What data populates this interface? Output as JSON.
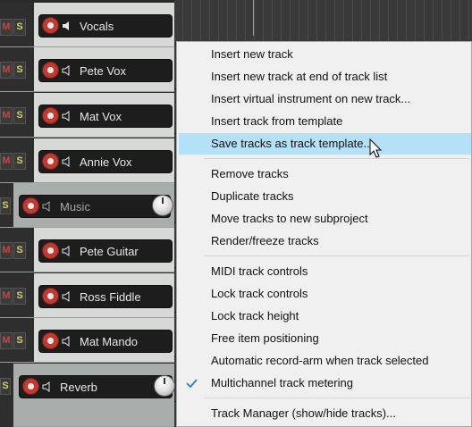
{
  "tracks": [
    {
      "name": "Vocals",
      "mute": "M",
      "solo": "S"
    },
    {
      "name": "Pete Vox",
      "mute": "M",
      "solo": "S"
    },
    {
      "name": "Mat Vox",
      "mute": "M",
      "solo": "S"
    },
    {
      "name": "Annie Vox",
      "mute": "M",
      "solo": "S"
    },
    {
      "name": "Music",
      "solo": "S"
    },
    {
      "name": "Pete Guitar",
      "mute": "M",
      "solo": "S"
    },
    {
      "name": "Ross Fiddle",
      "mute": "M",
      "solo": "S"
    },
    {
      "name": "Mat Mando",
      "mute": "M",
      "solo": "S"
    },
    {
      "name": "Reverb",
      "solo": "S"
    }
  ],
  "menu": {
    "items": [
      "Insert new track",
      "Insert new track at end of track list",
      "Insert virtual instrument on new track...",
      "Insert track from template",
      "Save tracks as track template...",
      "Remove tracks",
      "Duplicate tracks",
      "Move tracks to new subproject",
      "Render/freeze tracks",
      "MIDI track controls",
      "Lock track controls",
      "Lock track height",
      "Free item positioning",
      "Automatic record-arm when track selected",
      "Multichannel track metering",
      "Track Manager (show/hide tracks)..."
    ],
    "highlighted_index": 4,
    "checked_index": 14
  },
  "colors": {
    "highlight": "#b3e1f7",
    "record_arm": "#c03a30",
    "check": "#2a7fc9"
  }
}
